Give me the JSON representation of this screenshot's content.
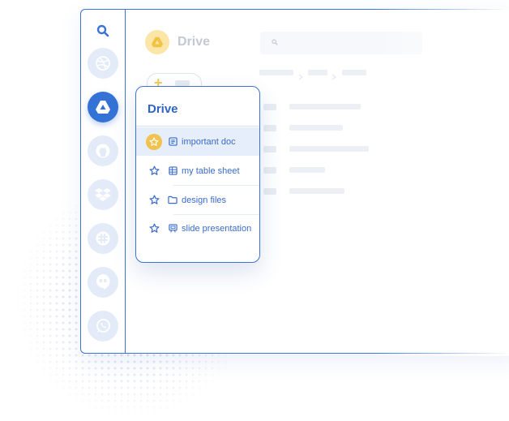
{
  "header": {
    "title": "Drive"
  },
  "sidebar": {
    "apps": [
      {
        "name": "search-icon"
      },
      {
        "name": "dribbble-icon"
      },
      {
        "name": "google-drive-icon",
        "active": true
      },
      {
        "name": "github-icon"
      },
      {
        "name": "dropbox-icon"
      },
      {
        "name": "slack-icon"
      },
      {
        "name": "hangouts-icon"
      },
      {
        "name": "whatsapp-icon"
      }
    ]
  },
  "popup": {
    "title": "Drive",
    "items": [
      {
        "label": "important doc",
        "icon": "document-icon",
        "starred": true
      },
      {
        "label": "my table sheet",
        "icon": "table-icon",
        "starred": false
      },
      {
        "label": "design files",
        "icon": "folder-icon",
        "starred": false
      },
      {
        "label": "slide presentation",
        "icon": "presentation-icon",
        "starred": false
      }
    ]
  },
  "colors": {
    "accent": "#3c74d6",
    "star": "#f1c24d",
    "popup_text": "#3b6bc9"
  }
}
